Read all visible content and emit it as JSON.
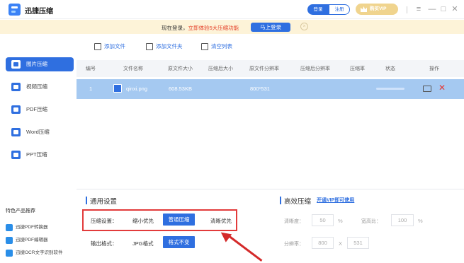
{
  "app": {
    "title": "迅捷压缩"
  },
  "header": {
    "login_label": "登录",
    "register_label": "注册",
    "vip_label": "购买VIP",
    "win_menu": "≡",
    "win_min": "—",
    "win_max": "□",
    "win_close": "✕"
  },
  "banner": {
    "text": "现在登录，",
    "highlight": "立即体验5大压缩功能",
    "login_button": "马上登录",
    "close": "×"
  },
  "sidebar": {
    "items": [
      {
        "label": "图片压缩",
        "active": true
      },
      {
        "label": "视频压缩",
        "active": false
      },
      {
        "label": "PDF压缩",
        "active": false
      },
      {
        "label": "Word压缩",
        "active": false
      },
      {
        "label": "PPT压缩",
        "active": false
      }
    ],
    "promo_title": "特色产品推荐",
    "promo_items": [
      {
        "label": "迅捷PDF转换器"
      },
      {
        "label": "迅捷PDF编辑器"
      },
      {
        "label": "迅捷OCR文字识别软件"
      }
    ]
  },
  "toolbar": {
    "add_file": "添加文件",
    "add_folder": "添加文件夹",
    "clear_list": "清空列表"
  },
  "table": {
    "headers": [
      "编号",
      "文件名称",
      "原文件大小",
      "压缩后大小",
      "原文件分辨率",
      "压缩后分辨率",
      "压缩率",
      "状态",
      "操作"
    ],
    "rows": [
      {
        "index": "1",
        "name": "qinxi.png",
        "orig_size": "608.53KB",
        "new_size": "",
        "orig_res": "800*531",
        "new_res": "",
        "ratio": "",
        "status": ""
      }
    ]
  },
  "settings": {
    "general_title": "通用设置",
    "compress_label": "压缩设置：",
    "compress_options": [
      "缩小优先",
      "普通压缩",
      "清晰优先"
    ],
    "compress_selected": "普通压缩",
    "output_label": "输出格式：",
    "output_options": [
      "JPG格式",
      "格式不变"
    ],
    "output_selected": "格式不变",
    "advanced_title": "高效压缩",
    "vip_link": "开通VIP即可使用",
    "clarity_label": "清晰度：",
    "clarity_value": "50",
    "clarity_unit": "%",
    "aspect_label": "宽高比：",
    "aspect_value": "100",
    "aspect_unit": "%",
    "resolution_label": "分辨率：",
    "res_width": "800",
    "res_x": "X",
    "res_height": "531"
  },
  "colors": {
    "accent": "#2f6fe0",
    "annotation": "#e23b3b",
    "banner_bg": "#fdf3d8",
    "row_selected": "#a5c9f1"
  }
}
